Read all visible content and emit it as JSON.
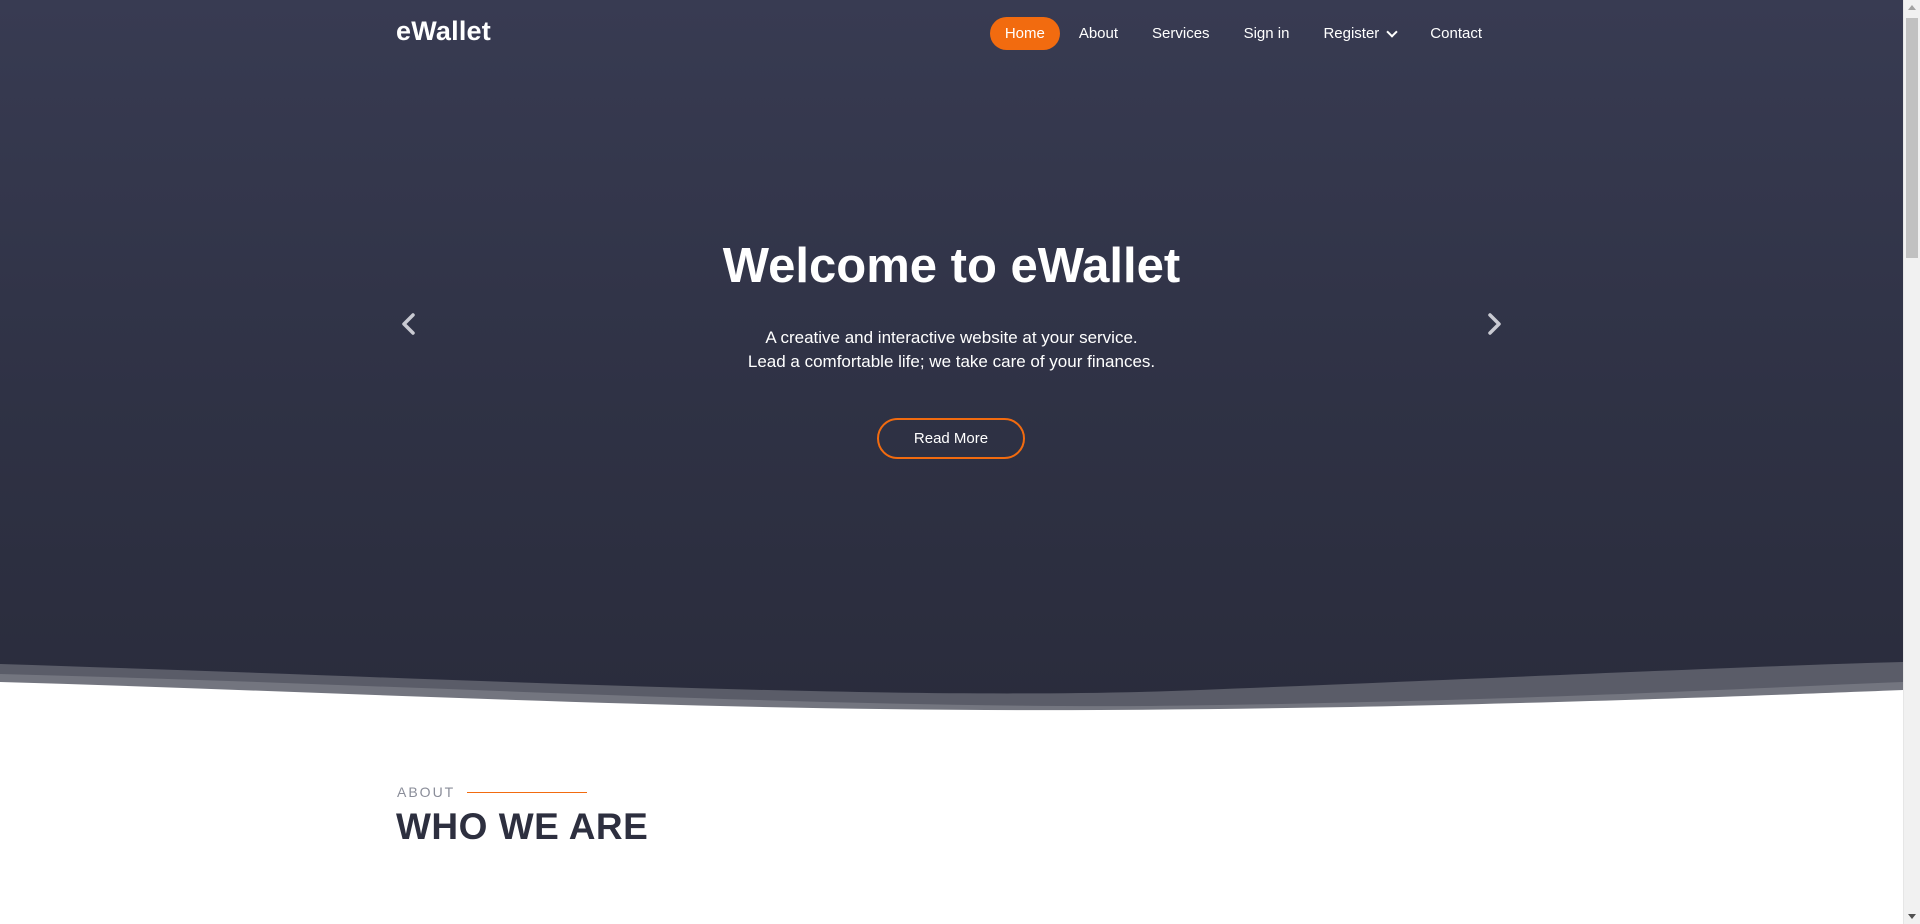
{
  "header": {
    "logo": "eWallet",
    "nav": [
      {
        "label": "Home",
        "active": true
      },
      {
        "label": "About",
        "active": false
      },
      {
        "label": "Services",
        "active": false
      },
      {
        "label": "Sign in",
        "active": false
      },
      {
        "label": "Register",
        "active": false,
        "dropdown": true
      },
      {
        "label": "Contact",
        "active": false
      }
    ]
  },
  "hero": {
    "title": "Welcome to eWallet",
    "line1": "A creative and interactive website at your service.",
    "line2": "Lead a comfortable life; we take care of your finances.",
    "button": "Read More",
    "prev_icon": "chevron-left-icon",
    "next_icon": "chevron-right-icon"
  },
  "about": {
    "eyebrow": "ABOUT",
    "title": "WHO WE ARE"
  },
  "colors": {
    "accent": "#f26b0f",
    "hero_bg": "#33364a",
    "heading_dark": "#2d2f3f"
  }
}
